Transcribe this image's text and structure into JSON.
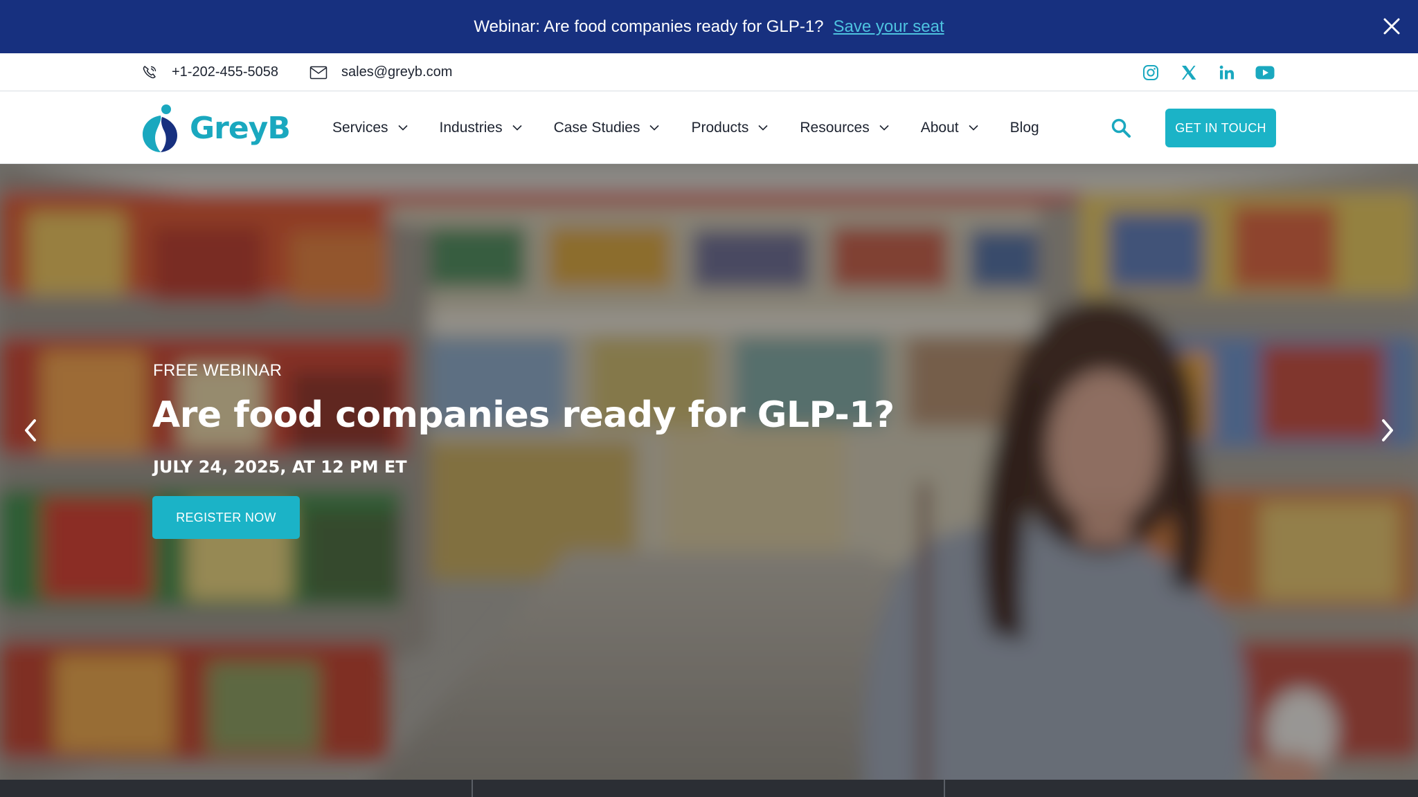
{
  "announcement": {
    "text": "Webinar: Are food companies ready for GLP-1?",
    "link_label": "Save your seat"
  },
  "contact": {
    "phone": "+1-202-455-5058",
    "email": "sales@greyb.com"
  },
  "social": [
    "instagram-icon",
    "x-icon",
    "linkedin-icon",
    "youtube-icon"
  ],
  "nav": {
    "logo_text": "GreyB",
    "items": [
      {
        "label": "Services",
        "has_dropdown": true
      },
      {
        "label": "Industries",
        "has_dropdown": true
      },
      {
        "label": "Case Studies",
        "has_dropdown": true
      },
      {
        "label": "Products",
        "has_dropdown": true
      },
      {
        "label": "Resources",
        "has_dropdown": true
      },
      {
        "label": "About",
        "has_dropdown": true
      },
      {
        "label": "Blog",
        "has_dropdown": false
      }
    ],
    "cta_label": "GET IN TOUCH"
  },
  "hero": {
    "eyebrow": "FREE WEBINAR",
    "headline": "Are food companies ready for GLP-1?",
    "date": "JULY 24, 2025, AT 12 PM ET",
    "button_label": "REGISTER NOW"
  },
  "colors": {
    "announcement_bg": "#17307f",
    "accent": "#1bb3c7",
    "link": "#4ec3e0"
  }
}
